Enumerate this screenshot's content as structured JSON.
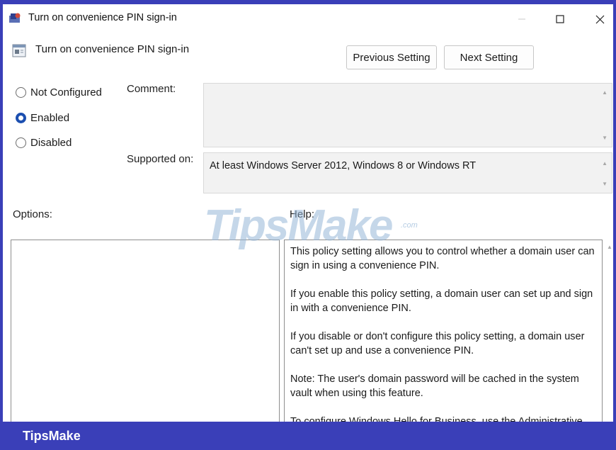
{
  "window": {
    "title": "Turn on convenience PIN sign-in",
    "controls": {
      "minimize_icon": "minimize-icon",
      "maximize_icon": "maximize-icon",
      "close_icon": "close-icon"
    }
  },
  "header": {
    "policy_name": "Turn on convenience PIN sign-in",
    "previous_label": "Previous Setting",
    "next_label": "Next Setting"
  },
  "state": {
    "options": [
      {
        "label": "Not Configured",
        "selected": false
      },
      {
        "label": "Enabled",
        "selected": true
      },
      {
        "label": "Disabled",
        "selected": false
      }
    ]
  },
  "fields": {
    "comment_label": "Comment:",
    "comment_value": "",
    "supported_label": "Supported on:",
    "supported_value": "At least Windows Server 2012, Windows 8 or Windows RT"
  },
  "panes": {
    "options_label": "Options:",
    "help_label": "Help:",
    "help_paragraphs": [
      "This policy setting allows you to control whether a domain user can sign in using a convenience PIN.",
      "If you enable this policy setting, a domain user can set up and sign in with a convenience PIN.",
      "If you disable or don't configure this policy setting, a domain user can't set up and use a convenience PIN.",
      "Note: The user's domain password will be cached in the system vault when using this feature.",
      "To configure Windows Hello for Business, use the Administrative"
    ]
  },
  "watermark": {
    "text": "TipsMake",
    "suffix": ".com"
  },
  "footer": {
    "brand": "TipsMake"
  },
  "colors": {
    "frame": "#3a3fb8",
    "radio_selected": "#1c4fb0",
    "field_bg": "#f2f2f2"
  }
}
